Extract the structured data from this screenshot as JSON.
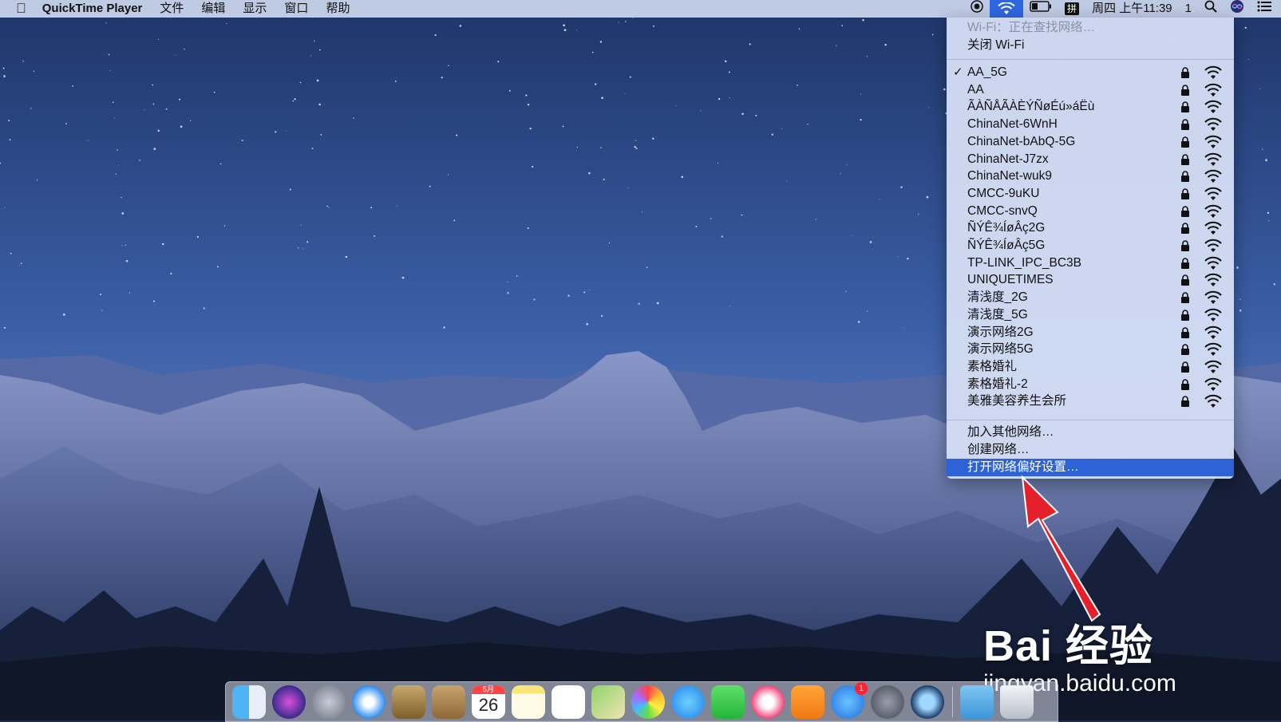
{
  "menubar": {
    "app_name": "QuickTime Player",
    "menus": [
      "文件",
      "编辑",
      "显示",
      "窗口",
      "帮助"
    ],
    "input_method": "拼",
    "clock": "周四 上午11:39",
    "notification_count": "1"
  },
  "wifi_menu": {
    "status": "Wi-Fi：正在查找网络…",
    "toggle_label": "关闭 Wi-Fi",
    "connected_check": "✓",
    "networks": [
      {
        "name": "AA_5G",
        "connected": true
      },
      {
        "name": "AA"
      },
      {
        "name": "ÃÀÑÅÃÀÈÝÑøÉú»áËù"
      },
      {
        "name": "ChinaNet-6WnH"
      },
      {
        "name": "ChinaNet-bAbQ-5G"
      },
      {
        "name": "ChinaNet-J7zx"
      },
      {
        "name": "ChinaNet-wuk9"
      },
      {
        "name": "CMCC-9uKU"
      },
      {
        "name": "CMCC-snvQ"
      },
      {
        "name": "ÑÝÊ¾ÍøÂç2G"
      },
      {
        "name": "ÑÝÊ¾ÍøÂç5G"
      },
      {
        "name": "TP-LINK_IPC_BC3B"
      },
      {
        "name": "UNIQUETIMES"
      },
      {
        "name": "清浅度_2G"
      },
      {
        "name": "清浅度_5G"
      },
      {
        "name": "演示网络2G"
      },
      {
        "name": "演示网络5G"
      },
      {
        "name": "素格婚礼"
      },
      {
        "name": "素格婚礼-2"
      },
      {
        "name": "美雅美容养生会所"
      }
    ],
    "actions": [
      "加入其他网络…",
      "创建网络…",
      "打开网络偏好设置…"
    ]
  },
  "dock": {
    "calendar_month": "5月",
    "calendar_day": "26",
    "appstore_badge": "1"
  },
  "watermark": {
    "brand": "Bai 经验",
    "url": "jingyan.baidu.com"
  }
}
